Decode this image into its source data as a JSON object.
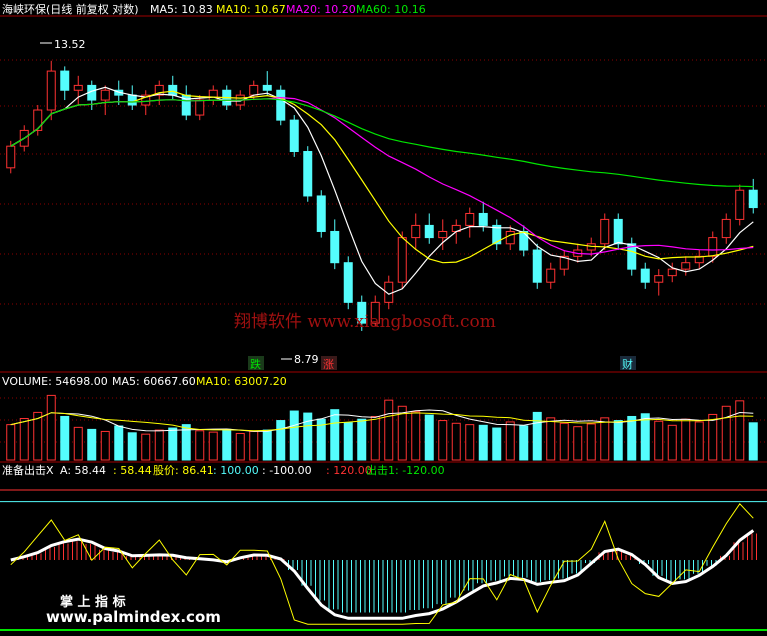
{
  "chart_data": [
    {
      "type": "candlestick",
      "header": {
        "name": "海峡环保(日线 前复权 对数)",
        "ma5": "MA5: 10.83",
        "ma10": "MA10: 10.67",
        "ma20": "MA20: 10.20",
        "ma60": "MA60: 10.16"
      },
      "high_label": "13.52",
      "low_label": "8.79",
      "markers": {
        "fall": "跌",
        "rise": "涨",
        "finance": "财"
      },
      "watermark": "翔博软件 www.xiangbosoft.com",
      "ohlc": [
        [
          11.4,
          11.9,
          11.3,
          11.8
        ],
        [
          11.8,
          12.2,
          11.7,
          12.1
        ],
        [
          12.1,
          12.6,
          12.0,
          12.5
        ],
        [
          12.5,
          13.52,
          12.3,
          13.3
        ],
        [
          13.3,
          13.4,
          12.7,
          12.9
        ],
        [
          12.9,
          13.2,
          12.6,
          13.0
        ],
        [
          13.0,
          13.1,
          12.5,
          12.7
        ],
        [
          12.7,
          13.0,
          12.4,
          12.9
        ],
        [
          12.9,
          13.1,
          12.6,
          12.8
        ],
        [
          12.8,
          13.0,
          12.5,
          12.6
        ],
        [
          12.6,
          12.9,
          12.4,
          12.8
        ],
        [
          12.8,
          13.1,
          12.6,
          13.0
        ],
        [
          13.0,
          13.2,
          12.7,
          12.8
        ],
        [
          12.8,
          13.0,
          12.3,
          12.4
        ],
        [
          12.4,
          12.8,
          12.3,
          12.7
        ],
        [
          12.7,
          13.0,
          12.6,
          12.9
        ],
        [
          12.9,
          13.0,
          12.5,
          12.6
        ],
        [
          12.6,
          12.9,
          12.5,
          12.8
        ],
        [
          12.8,
          13.1,
          12.7,
          13.0
        ],
        [
          13.0,
          13.3,
          12.8,
          12.9
        ],
        [
          12.9,
          13.0,
          12.2,
          12.3
        ],
        [
          12.3,
          12.4,
          11.6,
          11.7
        ],
        [
          11.7,
          11.8,
          10.8,
          10.9
        ],
        [
          10.9,
          11.0,
          10.2,
          10.3
        ],
        [
          10.3,
          10.5,
          9.7,
          9.8
        ],
        [
          9.8,
          9.9,
          9.1,
          9.2
        ],
        [
          9.2,
          9.3,
          8.79,
          8.9
        ],
        [
          8.9,
          9.3,
          8.85,
          9.2
        ],
        [
          9.2,
          9.6,
          9.1,
          9.5
        ],
        [
          9.5,
          10.3,
          9.4,
          10.2
        ],
        [
          10.2,
          10.6,
          10.0,
          10.4
        ],
        [
          10.4,
          10.6,
          10.1,
          10.2
        ],
        [
          10.2,
          10.5,
          10.0,
          10.3
        ],
        [
          10.3,
          10.5,
          10.1,
          10.4
        ],
        [
          10.4,
          10.7,
          10.2,
          10.6
        ],
        [
          10.6,
          10.8,
          10.3,
          10.4
        ],
        [
          10.4,
          10.5,
          10.0,
          10.1
        ],
        [
          10.1,
          10.4,
          10.0,
          10.3
        ],
        [
          10.3,
          10.4,
          9.9,
          10.0
        ],
        [
          10.0,
          10.1,
          9.4,
          9.5
        ],
        [
          9.5,
          9.8,
          9.4,
          9.7
        ],
        [
          9.7,
          10.0,
          9.6,
          9.9
        ],
        [
          9.9,
          10.1,
          9.8,
          10.0
        ],
        [
          10.0,
          10.2,
          9.9,
          10.1
        ],
        [
          10.1,
          10.6,
          10.0,
          10.5
        ],
        [
          10.5,
          10.6,
          10.0,
          10.1
        ],
        [
          10.1,
          10.2,
          9.6,
          9.7
        ],
        [
          9.7,
          9.8,
          9.4,
          9.5
        ],
        [
          9.5,
          9.7,
          9.3,
          9.6
        ],
        [
          9.6,
          9.8,
          9.5,
          9.7
        ],
        [
          9.7,
          9.9,
          9.6,
          9.8
        ],
        [
          9.8,
          10.0,
          9.7,
          9.9
        ],
        [
          9.9,
          10.3,
          9.8,
          10.2
        ],
        [
          10.2,
          10.6,
          10.1,
          10.5
        ],
        [
          10.5,
          11.1,
          10.4,
          11.0
        ],
        [
          11.0,
          11.2,
          10.6,
          10.7
        ]
      ],
      "volume_header": {
        "volume": "VOLUME: 54698.00",
        "ma5": "MA5: 60667.60",
        "ma10": "MA10: 63007.20"
      },
      "volume": [
        52000,
        61000,
        70000,
        95000,
        64000,
        48000,
        45000,
        42000,
        50000,
        40000,
        38000,
        44000,
        47000,
        52000,
        43000,
        41000,
        45000,
        39000,
        42000,
        44000,
        58000,
        72000,
        69000,
        60000,
        74000,
        55000,
        60000,
        64000,
        88000,
        79000,
        71000,
        66000,
        58000,
        54000,
        52000,
        51000,
        47000,
        56000,
        50000,
        70000,
        62000,
        54000,
        49000,
        53000,
        62000,
        58000,
        64000,
        68000,
        57000,
        51000,
        60000,
        56000,
        67000,
        79000,
        87000,
        54698
      ],
      "indicator_header": {
        "name": "准备出击X",
        "a": "A: 58.44",
        "b": ": 58.44",
        "price": "股价: 86.41",
        "c": ": 100.00",
        "d": ": -100.00",
        "e": ": 120.00",
        "f": "出击1: -120.00"
      },
      "indicator_wm": "掌 上 指 标",
      "indicator_url": "www.palmindex.com",
      "colors": {
        "up": "#ff3232",
        "down": "#54fcfc",
        "ma5": "#ffffff",
        "ma10": "#ffff00",
        "ma20": "#ff00ff",
        "ma60": "#00e600",
        "grid": "#8b0000"
      }
    }
  ]
}
